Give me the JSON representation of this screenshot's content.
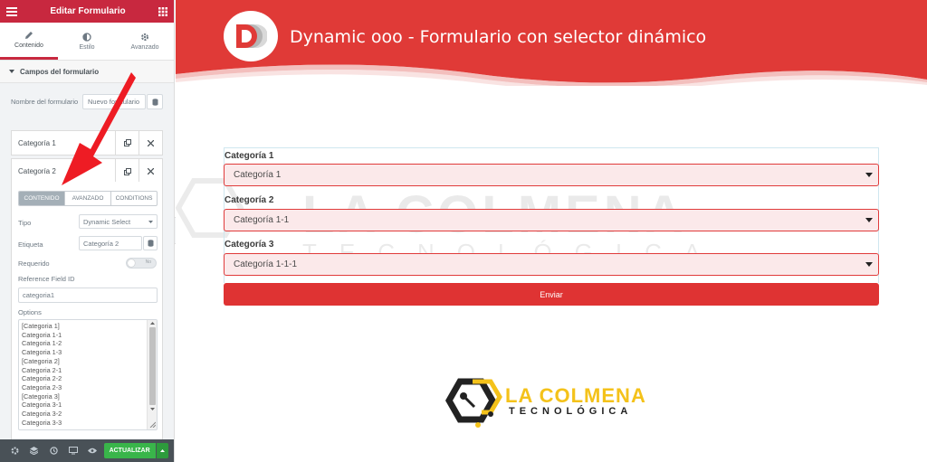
{
  "sidebar": {
    "title": "Editar Formulario",
    "tabs": [
      {
        "label": "Contenido",
        "icon": "pencil-icon"
      },
      {
        "label": "Estilo",
        "icon": "contrast-icon"
      },
      {
        "label": "Avanzado",
        "icon": "gear-icon"
      }
    ],
    "section_title": "Campos del formulario",
    "form_name_label": "Nombre del formulario",
    "form_name_value": "Nuevo formulario",
    "repeater_items": [
      {
        "label": "Categoría 1"
      },
      {
        "label": "Categoría 2"
      }
    ],
    "inner_tabs": [
      "CONTENIDO",
      "AVANZADO",
      "CONDITIONS"
    ],
    "type_label": "Tipo",
    "type_value": "Dynamic Select",
    "etiqueta_label": "Etiqueta",
    "etiqueta_value": "Categoría 2",
    "requerido_label": "Requerido",
    "requerido_toggle": "No",
    "reference_label": "Reference Field ID",
    "reference_value": "categoria1",
    "options_label": "Options",
    "options": [
      "[Categoria 1]",
      "Categoria 1-1",
      "Categoria 1-2",
      "Categoria 1-3",
      "[Categoria 2]",
      "Categoria 2-1",
      "Categoria 2-2",
      "Categoria 2-3",
      "[Categoria 3]",
      "Categoria 3-1",
      "Categoria 3-2",
      "Categoria 3-3"
    ],
    "update_label": "ACTUALIZAR"
  },
  "preview": {
    "hero_title": "Dynamic ooo - Formulario con selector dinámico",
    "fields": [
      {
        "label": "Categoría 1",
        "value": "Categoría 1"
      },
      {
        "label": "Categoría 2",
        "value": "Categoría 1-1"
      },
      {
        "label": "Categoría 3",
        "value": "Categoría 1-1-1"
      }
    ],
    "submit_label": "Enviar",
    "watermark_line1": "LA COLMENA",
    "watermark_line2": "TECNOLÓGICA",
    "brand_line1": "LA COLMENA",
    "brand_line2": "TECNOLÓGICA"
  },
  "colors": {
    "editor_red": "#c8283f",
    "hero_red": "#e03a37",
    "select_bg": "#fbe9ea",
    "submit_bg": "#df3333",
    "update_green": "#39b54a",
    "brand_yellow": "#f4c21a"
  }
}
